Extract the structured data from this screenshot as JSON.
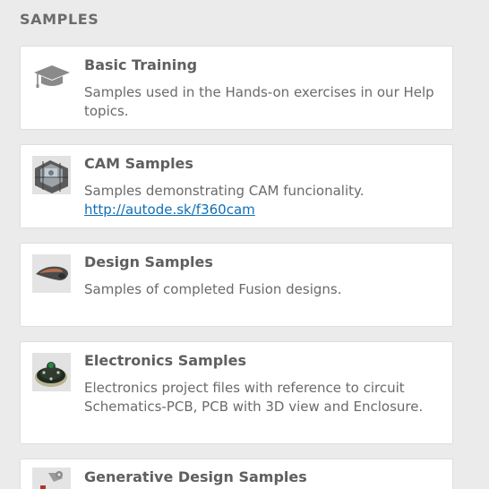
{
  "section": {
    "title": "SAMPLES"
  },
  "cards": [
    {
      "title": "Basic Training",
      "description": "Samples used in the Hands-on exercises in our Help topics.",
      "icon": "graduation-cap-icon"
    },
    {
      "title": "CAM Samples",
      "description": "Samples demonstrating CAM funcionality.",
      "link": "http://autode.sk/f360cam",
      "icon": "cam-machining-thumbnail"
    },
    {
      "title": "Design Samples",
      "description": "Samples of completed Fusion designs.",
      "icon": "design-model-thumbnail"
    },
    {
      "title": "Electronics Samples",
      "description": "Electronics project files with reference to circuit Schematics-PCB, PCB with 3D view and Enclosure.",
      "icon": "electronics-board-thumbnail"
    },
    {
      "title": "Generative Design Samples",
      "description": "",
      "icon": "generative-design-thumbnail"
    }
  ],
  "colors": {
    "background": "#ebebeb",
    "card": "#ffffff",
    "link": "#0f6fb8",
    "title": "#5f5f5f"
  }
}
